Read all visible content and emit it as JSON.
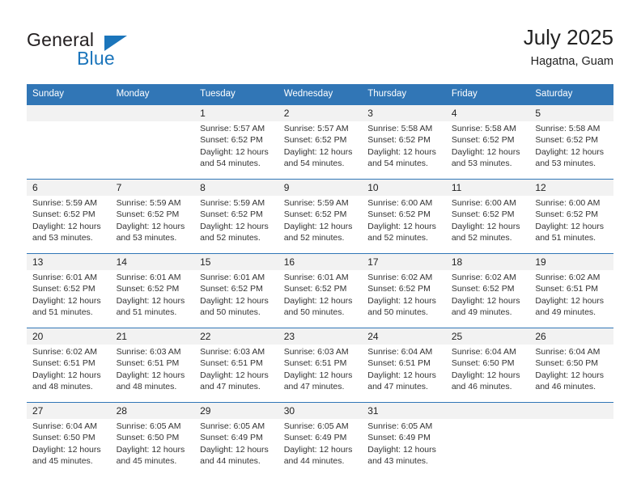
{
  "brand": {
    "name_top": "General",
    "name_bottom": "Blue",
    "accent_color": "#1b75bb"
  },
  "header": {
    "title": "July 2025",
    "subtitle": "Hagatna, Guam"
  },
  "theme": {
    "header_blue": "#3176b6",
    "daynum_band": "#f2f2f2",
    "text": "#222222"
  },
  "weekday_headers": [
    "Sunday",
    "Monday",
    "Tuesday",
    "Wednesday",
    "Thursday",
    "Friday",
    "Saturday"
  ],
  "weeks": [
    [
      {
        "day": "",
        "sunrise": "",
        "sunset": "",
        "daylight_a": "",
        "daylight_b": ""
      },
      {
        "day": "",
        "sunrise": "",
        "sunset": "",
        "daylight_a": "",
        "daylight_b": ""
      },
      {
        "day": "1",
        "sunrise": "Sunrise: 5:57 AM",
        "sunset": "Sunset: 6:52 PM",
        "daylight_a": "Daylight: 12 hours",
        "daylight_b": "and 54 minutes."
      },
      {
        "day": "2",
        "sunrise": "Sunrise: 5:57 AM",
        "sunset": "Sunset: 6:52 PM",
        "daylight_a": "Daylight: 12 hours",
        "daylight_b": "and 54 minutes."
      },
      {
        "day": "3",
        "sunrise": "Sunrise: 5:58 AM",
        "sunset": "Sunset: 6:52 PM",
        "daylight_a": "Daylight: 12 hours",
        "daylight_b": "and 54 minutes."
      },
      {
        "day": "4",
        "sunrise": "Sunrise: 5:58 AM",
        "sunset": "Sunset: 6:52 PM",
        "daylight_a": "Daylight: 12 hours",
        "daylight_b": "and 53 minutes."
      },
      {
        "day": "5",
        "sunrise": "Sunrise: 5:58 AM",
        "sunset": "Sunset: 6:52 PM",
        "daylight_a": "Daylight: 12 hours",
        "daylight_b": "and 53 minutes."
      }
    ],
    [
      {
        "day": "6",
        "sunrise": "Sunrise: 5:59 AM",
        "sunset": "Sunset: 6:52 PM",
        "daylight_a": "Daylight: 12 hours",
        "daylight_b": "and 53 minutes."
      },
      {
        "day": "7",
        "sunrise": "Sunrise: 5:59 AM",
        "sunset": "Sunset: 6:52 PM",
        "daylight_a": "Daylight: 12 hours",
        "daylight_b": "and 53 minutes."
      },
      {
        "day": "8",
        "sunrise": "Sunrise: 5:59 AM",
        "sunset": "Sunset: 6:52 PM",
        "daylight_a": "Daylight: 12 hours",
        "daylight_b": "and 52 minutes."
      },
      {
        "day": "9",
        "sunrise": "Sunrise: 5:59 AM",
        "sunset": "Sunset: 6:52 PM",
        "daylight_a": "Daylight: 12 hours",
        "daylight_b": "and 52 minutes."
      },
      {
        "day": "10",
        "sunrise": "Sunrise: 6:00 AM",
        "sunset": "Sunset: 6:52 PM",
        "daylight_a": "Daylight: 12 hours",
        "daylight_b": "and 52 minutes."
      },
      {
        "day": "11",
        "sunrise": "Sunrise: 6:00 AM",
        "sunset": "Sunset: 6:52 PM",
        "daylight_a": "Daylight: 12 hours",
        "daylight_b": "and 52 minutes."
      },
      {
        "day": "12",
        "sunrise": "Sunrise: 6:00 AM",
        "sunset": "Sunset: 6:52 PM",
        "daylight_a": "Daylight: 12 hours",
        "daylight_b": "and 51 minutes."
      }
    ],
    [
      {
        "day": "13",
        "sunrise": "Sunrise: 6:01 AM",
        "sunset": "Sunset: 6:52 PM",
        "daylight_a": "Daylight: 12 hours",
        "daylight_b": "and 51 minutes."
      },
      {
        "day": "14",
        "sunrise": "Sunrise: 6:01 AM",
        "sunset": "Sunset: 6:52 PM",
        "daylight_a": "Daylight: 12 hours",
        "daylight_b": "and 51 minutes."
      },
      {
        "day": "15",
        "sunrise": "Sunrise: 6:01 AM",
        "sunset": "Sunset: 6:52 PM",
        "daylight_a": "Daylight: 12 hours",
        "daylight_b": "and 50 minutes."
      },
      {
        "day": "16",
        "sunrise": "Sunrise: 6:01 AM",
        "sunset": "Sunset: 6:52 PM",
        "daylight_a": "Daylight: 12 hours",
        "daylight_b": "and 50 minutes."
      },
      {
        "day": "17",
        "sunrise": "Sunrise: 6:02 AM",
        "sunset": "Sunset: 6:52 PM",
        "daylight_a": "Daylight: 12 hours",
        "daylight_b": "and 50 minutes."
      },
      {
        "day": "18",
        "sunrise": "Sunrise: 6:02 AM",
        "sunset": "Sunset: 6:52 PM",
        "daylight_a": "Daylight: 12 hours",
        "daylight_b": "and 49 minutes."
      },
      {
        "day": "19",
        "sunrise": "Sunrise: 6:02 AM",
        "sunset": "Sunset: 6:51 PM",
        "daylight_a": "Daylight: 12 hours",
        "daylight_b": "and 49 minutes."
      }
    ],
    [
      {
        "day": "20",
        "sunrise": "Sunrise: 6:02 AM",
        "sunset": "Sunset: 6:51 PM",
        "daylight_a": "Daylight: 12 hours",
        "daylight_b": "and 48 minutes."
      },
      {
        "day": "21",
        "sunrise": "Sunrise: 6:03 AM",
        "sunset": "Sunset: 6:51 PM",
        "daylight_a": "Daylight: 12 hours",
        "daylight_b": "and 48 minutes."
      },
      {
        "day": "22",
        "sunrise": "Sunrise: 6:03 AM",
        "sunset": "Sunset: 6:51 PM",
        "daylight_a": "Daylight: 12 hours",
        "daylight_b": "and 47 minutes."
      },
      {
        "day": "23",
        "sunrise": "Sunrise: 6:03 AM",
        "sunset": "Sunset: 6:51 PM",
        "daylight_a": "Daylight: 12 hours",
        "daylight_b": "and 47 minutes."
      },
      {
        "day": "24",
        "sunrise": "Sunrise: 6:04 AM",
        "sunset": "Sunset: 6:51 PM",
        "daylight_a": "Daylight: 12 hours",
        "daylight_b": "and 47 minutes."
      },
      {
        "day": "25",
        "sunrise": "Sunrise: 6:04 AM",
        "sunset": "Sunset: 6:50 PM",
        "daylight_a": "Daylight: 12 hours",
        "daylight_b": "and 46 minutes."
      },
      {
        "day": "26",
        "sunrise": "Sunrise: 6:04 AM",
        "sunset": "Sunset: 6:50 PM",
        "daylight_a": "Daylight: 12 hours",
        "daylight_b": "and 46 minutes."
      }
    ],
    [
      {
        "day": "27",
        "sunrise": "Sunrise: 6:04 AM",
        "sunset": "Sunset: 6:50 PM",
        "daylight_a": "Daylight: 12 hours",
        "daylight_b": "and 45 minutes."
      },
      {
        "day": "28",
        "sunrise": "Sunrise: 6:05 AM",
        "sunset": "Sunset: 6:50 PM",
        "daylight_a": "Daylight: 12 hours",
        "daylight_b": "and 45 minutes."
      },
      {
        "day": "29",
        "sunrise": "Sunrise: 6:05 AM",
        "sunset": "Sunset: 6:49 PM",
        "daylight_a": "Daylight: 12 hours",
        "daylight_b": "and 44 minutes."
      },
      {
        "day": "30",
        "sunrise": "Sunrise: 6:05 AM",
        "sunset": "Sunset: 6:49 PM",
        "daylight_a": "Daylight: 12 hours",
        "daylight_b": "and 44 minutes."
      },
      {
        "day": "31",
        "sunrise": "Sunrise: 6:05 AM",
        "sunset": "Sunset: 6:49 PM",
        "daylight_a": "Daylight: 12 hours",
        "daylight_b": "and 43 minutes."
      },
      {
        "day": "",
        "sunrise": "",
        "sunset": "",
        "daylight_a": "",
        "daylight_b": ""
      },
      {
        "day": "",
        "sunrise": "",
        "sunset": "",
        "daylight_a": "",
        "daylight_b": ""
      }
    ]
  ]
}
